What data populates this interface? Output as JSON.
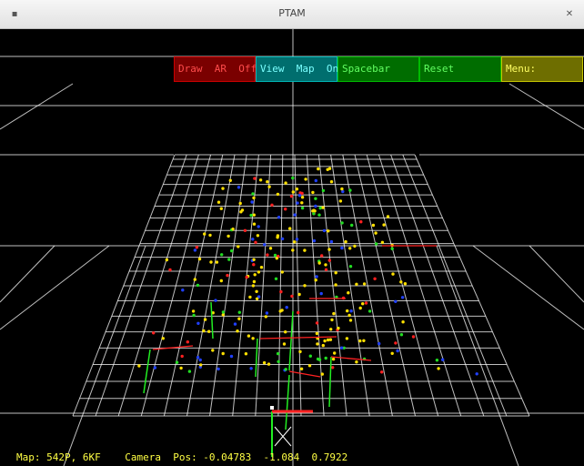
{
  "window": {
    "title": "PTAM",
    "left_control": "▪",
    "right_control": "✕"
  },
  "menu": {
    "draw_ar": "Draw  AR  Off",
    "view_map": "View  Map  On",
    "spacebar": "Spacebar",
    "reset": "Reset",
    "menu": "Menu:"
  },
  "status": {
    "map": "Map: 542P, 6KF",
    "camera_pos": "Camera  Pos: -0.04783  -1.084  0.7922"
  },
  "colors": {
    "grid": "#ffffff",
    "point_red": "#ff2020",
    "point_yellow": "#ffe000",
    "point_green": "#22dd22",
    "point_blue": "#2040ff",
    "keyframe_green": "#22ee22",
    "keyframe_red": "#ff2222"
  }
}
